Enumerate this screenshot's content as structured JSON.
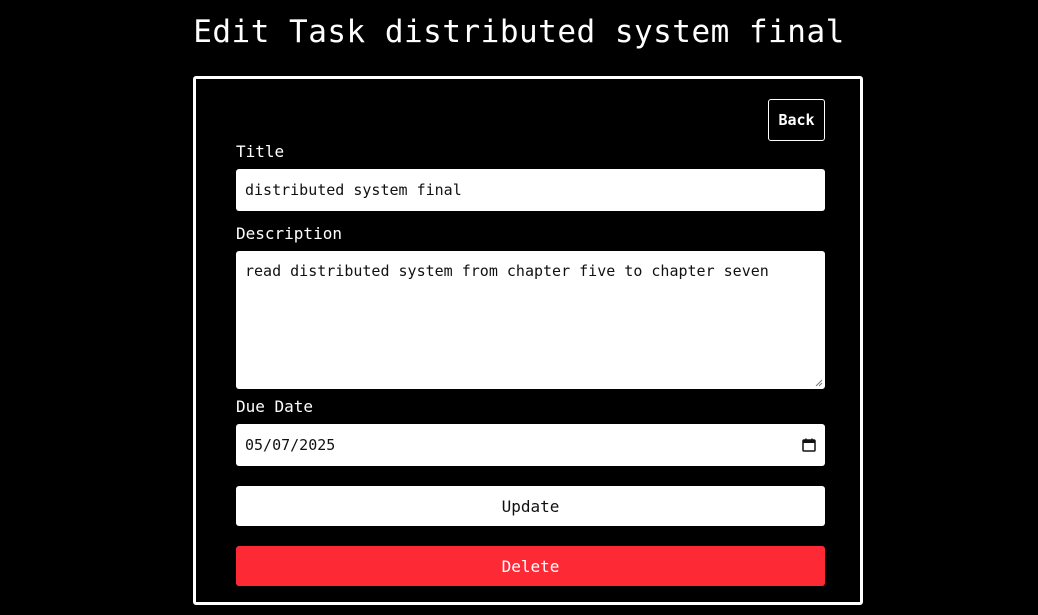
{
  "page": {
    "title": "Edit Task distributed system final"
  },
  "form": {
    "back_label": "Back",
    "title_label": "Title",
    "title_value": "distributed system final",
    "description_label": "Description",
    "description_value": "read distributed system from chapter five to chapter seven",
    "due_date_label": "Due Date",
    "due_date_value": "05/07/2025",
    "update_label": "Update",
    "delete_label": "Delete"
  },
  "colors": {
    "background": "#000000",
    "field_background": "#ffffff",
    "delete_button": "#fd2a36"
  },
  "icons": {
    "date_picker": "calendar-icon",
    "textarea_resize": "resize-grip-icon"
  }
}
